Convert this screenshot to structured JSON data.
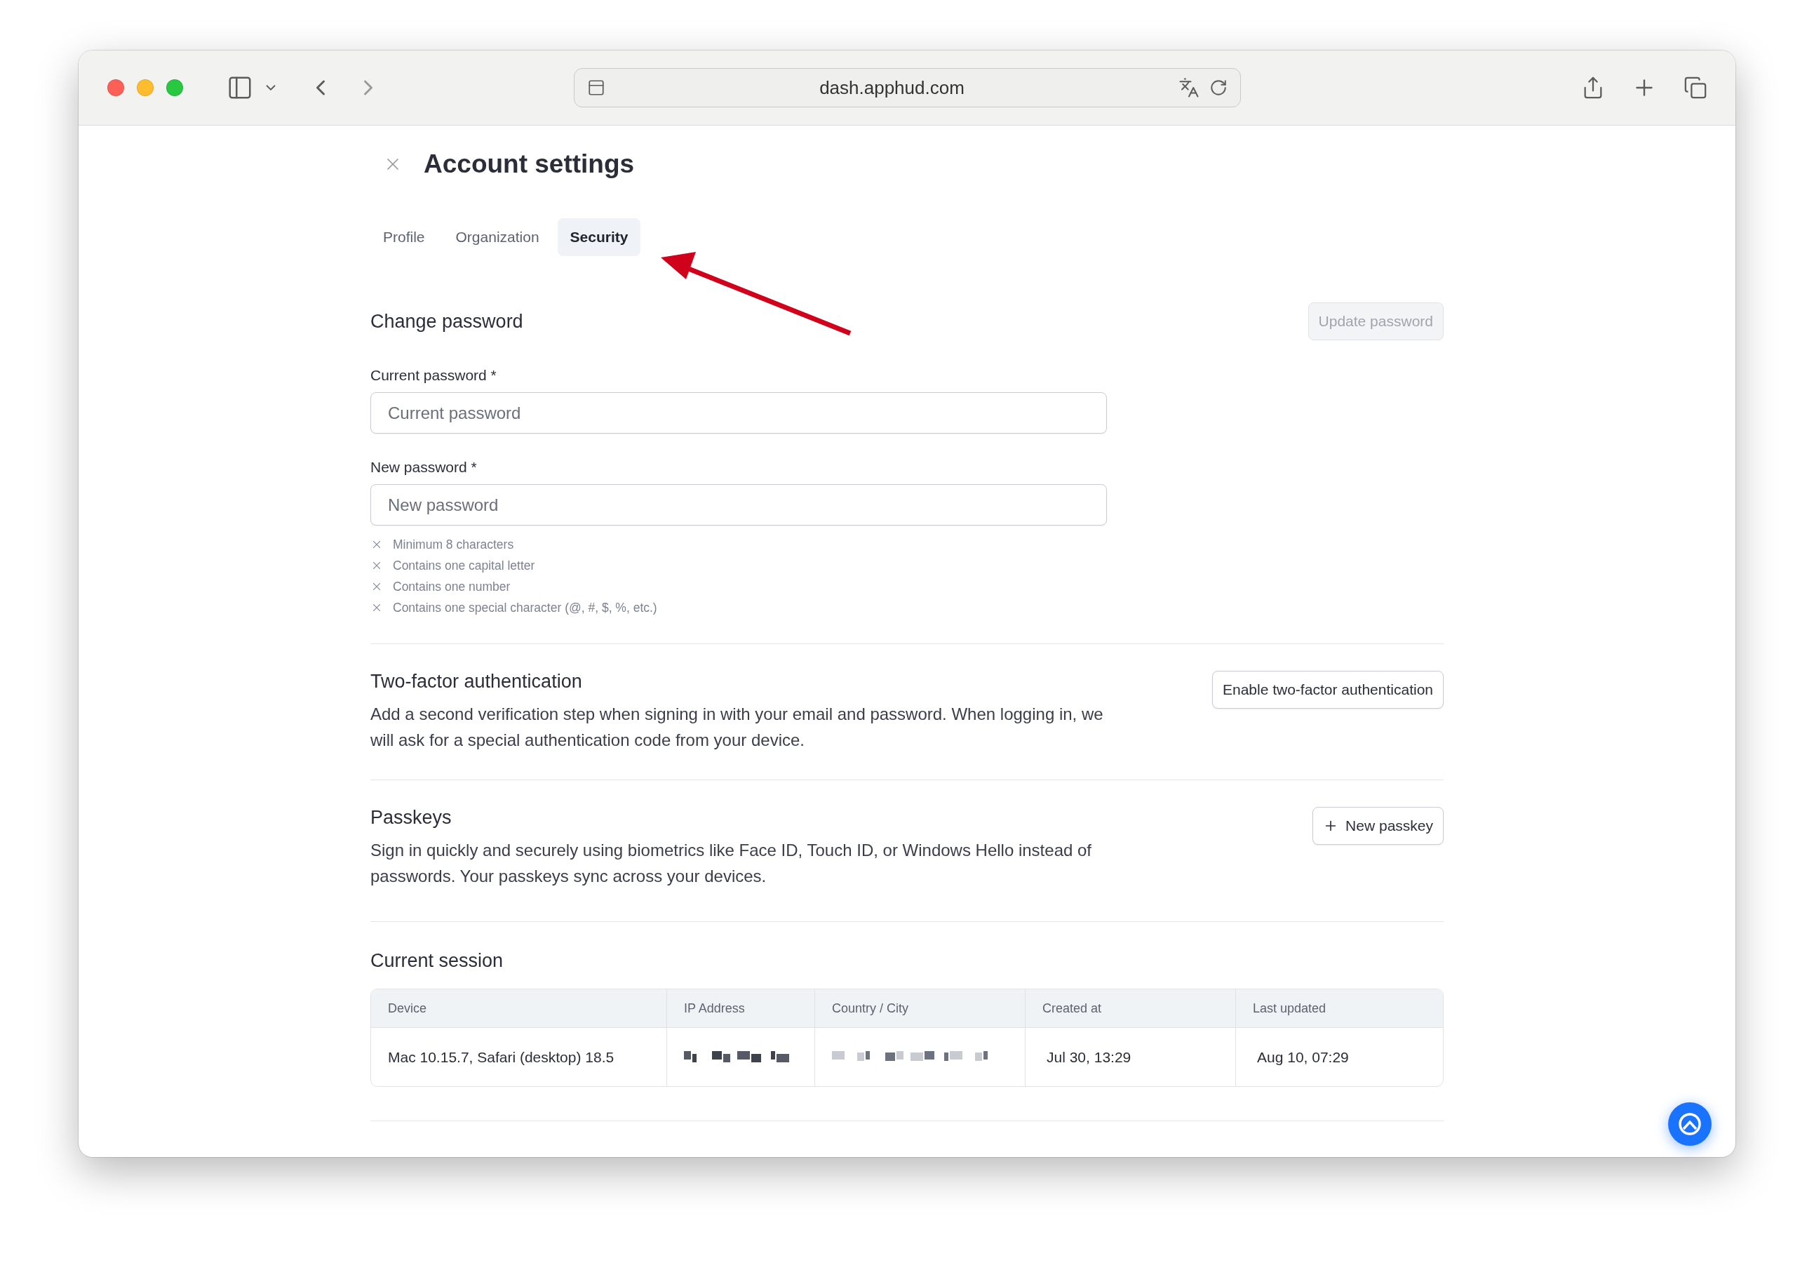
{
  "browser": {
    "url": "dash.apphud.com"
  },
  "page": {
    "title": "Account settings",
    "tabs": [
      {
        "label": "Profile",
        "selected": false
      },
      {
        "label": "Organization",
        "selected": false
      },
      {
        "label": "Security",
        "selected": true
      }
    ],
    "change_password": {
      "title": "Change password",
      "button": {
        "label": "Update password",
        "disabled": true
      },
      "fields": [
        {
          "label": "Current password *",
          "placeholder": "Current password"
        },
        {
          "label": "New password *",
          "placeholder": "New password"
        }
      ],
      "requirements": [
        {
          "text": "Minimum 8 characters",
          "met": false
        },
        {
          "text": "Contains one capital letter",
          "met": false
        },
        {
          "text": "Contains one number",
          "met": false
        },
        {
          "text": "Contains one special character (@, #, $, %, etc.)",
          "met": false
        }
      ]
    },
    "two_factor": {
      "title": "Two-factor authentication",
      "description": "Add a second verification step when signing in with your email and password. When logging in, we will ask for a special authentication code from your device.",
      "button": {
        "label": "Enable two-factor authentication"
      }
    },
    "passkeys": {
      "title": "Passkeys",
      "description": "Sign in quickly and securely using biometrics like Face ID, Touch ID, or Windows Hello instead of passwords. Your passkeys sync across your devices.",
      "button": {
        "label": "New passkey"
      }
    },
    "session": {
      "title": "Current session",
      "columns": [
        "Device",
        "IP Address",
        "Country / City",
        "Created at",
        "Last updated"
      ],
      "rows": [
        {
          "cells": [
            {
              "kind": "text",
              "text": "Mac 10.15.7, Safari (desktop) 18.5"
            },
            {
              "kind": "redacted"
            },
            {
              "kind": "redacted"
            },
            {
              "kind": "text",
              "text": "Jul 30, 13:29"
            },
            {
              "kind": "text",
              "text": "Aug 10, 07:29"
            }
          ]
        }
      ]
    }
  }
}
